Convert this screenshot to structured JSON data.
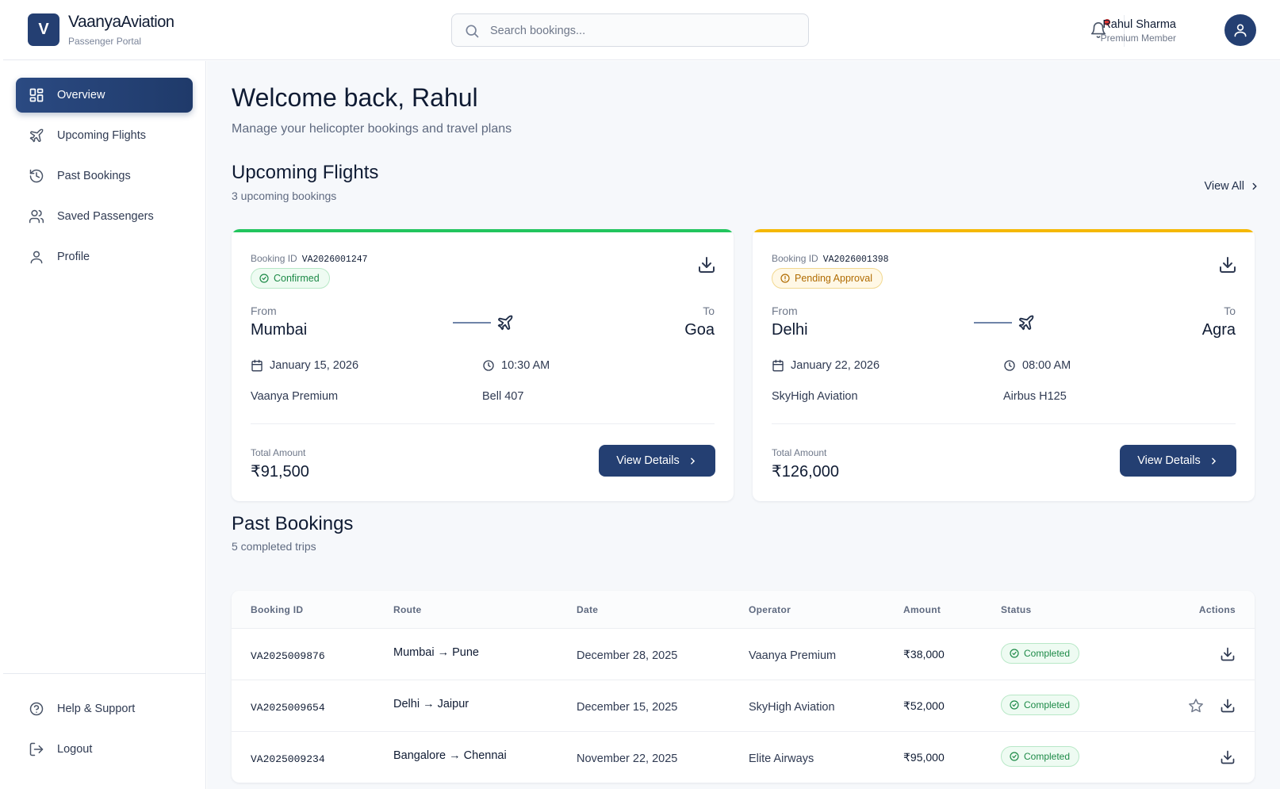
{
  "brand": {
    "logo_letter": "V",
    "name_part1": "Vaanya",
    "name_part2": "Aviation",
    "subtitle": "Passenger Portal"
  },
  "search": {
    "placeholder": "Search bookings...",
    "value": ""
  },
  "user": {
    "name": "Rahul Sharma",
    "tier": "Premium Member"
  },
  "sidebar": {
    "items": [
      {
        "label": "Overview",
        "icon": "grid-icon",
        "active": true
      },
      {
        "label": "Upcoming Flights",
        "icon": "plane-icon"
      },
      {
        "label": "Past Bookings",
        "icon": "history-icon"
      },
      {
        "label": "Saved Passengers",
        "icon": "users-icon"
      },
      {
        "label": "Profile",
        "icon": "user-icon"
      }
    ],
    "footer": [
      {
        "label": "Help & Support",
        "icon": "help-icon"
      },
      {
        "label": "Logout",
        "icon": "logout-icon"
      }
    ]
  },
  "main": {
    "welcome": "Welcome back, Rahul",
    "welcome_sub": "Manage your helicopter bookings and travel plans",
    "upcoming": {
      "title": "Upcoming Flights",
      "subtitle": "3 upcoming bookings",
      "view_all": "View All",
      "cards": [
        {
          "booking_label": "Booking ID",
          "booking_id": "VA2026001247",
          "status": "Confirmed",
          "status_color": "#22c55e",
          "from_label": "From",
          "from": "Mumbai",
          "to_label": "To",
          "to": "Goa",
          "date": "January 15, 2026",
          "time": "10:30 AM",
          "operator": "Vaanya Premium",
          "aircraft": "Bell 407",
          "total_label": "Total Amount",
          "total": "₹91,500",
          "button": "View Details"
        },
        {
          "booking_label": "Booking ID",
          "booking_id": "VA2026001398",
          "status": "Pending Approval",
          "status_color": "#f5b800",
          "from_label": "From",
          "from": "Delhi",
          "to_label": "To",
          "to": "Agra",
          "date": "January 22, 2026",
          "time": "08:00 AM",
          "operator": "SkyHigh Aviation",
          "aircraft": "Airbus H125",
          "total_label": "Total Amount",
          "total": "₹126,000",
          "button": "View Details"
        }
      ]
    },
    "past": {
      "title": "Past Bookings",
      "subtitle": "5 completed trips",
      "columns": [
        "Booking ID",
        "Route",
        "Date",
        "Operator",
        "Amount",
        "Status",
        "Actions"
      ],
      "rows": [
        {
          "id": "VA2025009876",
          "route": "Mumbai → Pune",
          "date": "December 28, 2025",
          "operator": "Vaanya Premium",
          "amount": "₹38,000",
          "status": "Completed",
          "rate": false
        },
        {
          "id": "VA2025009654",
          "route": "Delhi → Jaipur",
          "date": "December 15, 2025",
          "operator": "SkyHigh Aviation",
          "amount": "₹52,000",
          "status": "Completed",
          "rate": true
        },
        {
          "id": "VA2025009234",
          "route": "Bangalore → Chennai",
          "date": "November 22, 2025",
          "operator": "Elite Airways",
          "amount": "₹95,000",
          "status": "Completed",
          "rate": false
        }
      ]
    }
  }
}
